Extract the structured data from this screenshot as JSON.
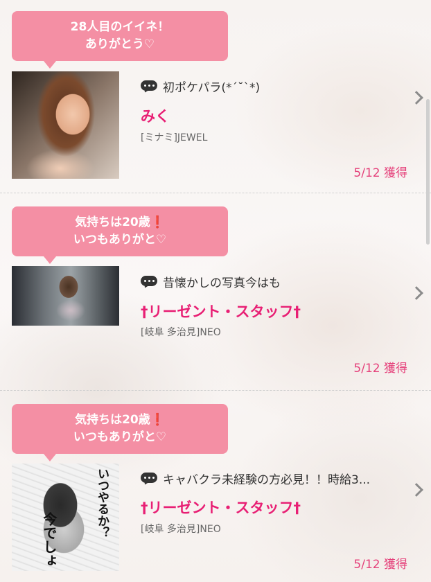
{
  "items": [
    {
      "bubble_line1": "28人目のイイネ！",
      "bubble_line2": "ありがとう♡",
      "message": "初ポケパラ(*´˘`*)",
      "name": "みく",
      "shop": "[ミナミ]JEWEL",
      "date": "5/12 獲得"
    },
    {
      "bubble_line1": "気持ちは20歳❗",
      "bubble_line2": "いつもありがと♡",
      "message": "昔懐かしの写真今はも",
      "name": "†リーゼント・スタッフ†",
      "shop": "[岐阜 多治見]NEO",
      "date": "5/12 獲得"
    },
    {
      "bubble_line1": "気持ちは20歳❗",
      "bubble_line2": "いつもありがと♡",
      "message": "キャバクラ未経験の方必見！！時給3...",
      "name": "†リーゼント・スタッフ†",
      "shop": "[岐阜 多治見]NEO",
      "date": "5/12 獲得",
      "thumb_text1": "いつやるか？",
      "thumb_text2": "今でしょ"
    }
  ]
}
